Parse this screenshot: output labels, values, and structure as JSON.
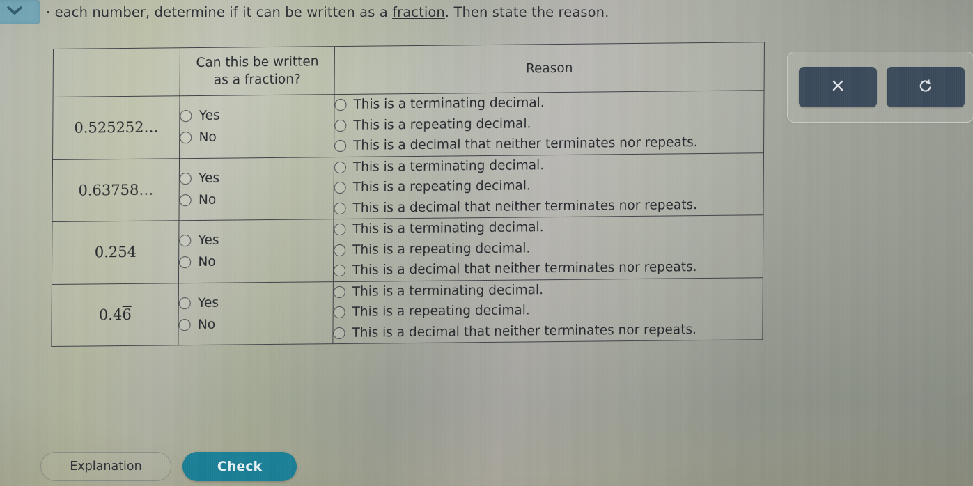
{
  "prompt": {
    "text_before": "· each number, determine if it can be written as a ",
    "link_text": "fraction",
    "text_after": ". Then state the reason.",
    "collapse_icon": "chevron-down-icon",
    "badge_color": "#74a7b7"
  },
  "table": {
    "headers": {
      "number": "",
      "fraction_line1": "Can this be written",
      "fraction_line2": "as a fraction?",
      "reason": "Reason"
    },
    "yes_no_options": [
      "Yes",
      "No"
    ],
    "reason_options": [
      "This is a terminating decimal.",
      "This is a repeating decimal.",
      "This is a decimal that neither terminates nor repeats."
    ],
    "rows": [
      {
        "number": "0.525252…",
        "number_overline": "",
        "number_suffix": ""
      },
      {
        "number": "0.63758…",
        "number_overline": "",
        "number_suffix": ""
      },
      {
        "number": "0.254",
        "number_overline": "",
        "number_suffix": ""
      },
      {
        "number": "0.4",
        "number_overline": "6",
        "number_suffix": ""
      }
    ]
  },
  "tool_panel": {
    "clear_icon": "close-x-icon",
    "undo_icon": "undo-arrow-icon",
    "button_color": "#3b4a5a"
  },
  "footer": {
    "explanation_label": "Explanation",
    "check_label": "Check",
    "check_color": "#1a7f96"
  }
}
